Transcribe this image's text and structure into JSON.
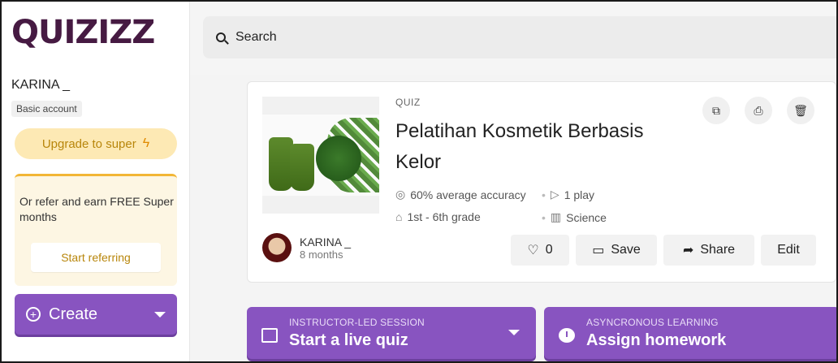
{
  "sidebar": {
    "logo": "QUIZIZZ",
    "username": "KARINA _",
    "account_type": "Basic account",
    "upgrade_label": "Upgrade to super",
    "refer_text": "Or refer and earn FREE Super months",
    "refer_button": "Start referring",
    "create_label": "Create"
  },
  "search": {
    "placeholder": "Search"
  },
  "quiz": {
    "type": "QUIZ",
    "title": "Pelatihan Kosmetik Berbasis Kelor",
    "accuracy": "60% average accuracy",
    "plays": "1 play",
    "grade": "1st - 6th grade",
    "subject": "Science",
    "author": {
      "name": "KARINA _",
      "time": "8 months"
    },
    "actions": {
      "likes": "0",
      "save": "Save",
      "share": "Share",
      "edit": "Edit"
    }
  },
  "sessions": {
    "live": {
      "kicker": "INSTRUCTOR-LED SESSION",
      "label": "Start a live quiz"
    },
    "homework": {
      "kicker": "ASYNCRONOUS LEARNING",
      "label": "Assign homework"
    }
  },
  "colors": {
    "brand_purple": "#8854c0",
    "logo": "#461a42",
    "upgrade_bg": "#fde9b4",
    "refer_accent": "#f2b636"
  },
  "icons": [
    "search-icon",
    "bolt-icon",
    "plus-circle-icon",
    "chevron-down-icon",
    "copy-icon",
    "print-icon",
    "trash-icon",
    "target-icon",
    "play-icon",
    "graduation-cap-icon",
    "books-icon",
    "heart-icon",
    "folder-icon",
    "share-icon",
    "whiteboard-icon",
    "clock-icon"
  ]
}
